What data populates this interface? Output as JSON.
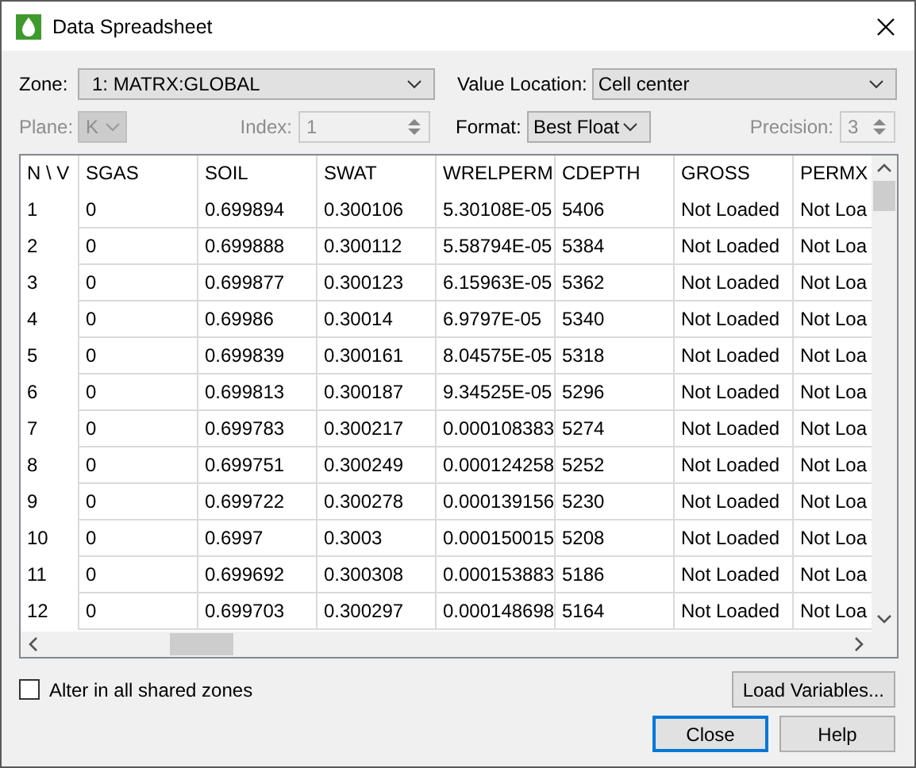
{
  "window": {
    "title": "Data Spreadsheet"
  },
  "zone": {
    "label": "Zone:",
    "value": "1: MATRX:GLOBAL"
  },
  "value_location": {
    "label": "Value Location:",
    "value": "Cell center"
  },
  "plane": {
    "label": "Plane:",
    "value": "K",
    "disabled": true
  },
  "index": {
    "label": "Index:",
    "value": "1",
    "disabled": true
  },
  "format": {
    "label": "Format:",
    "value": "Best Float"
  },
  "precision": {
    "label": "Precision:",
    "value": "3",
    "disabled": true
  },
  "table": {
    "columns": [
      "N \\ V",
      "SGAS",
      "SOIL",
      "SWAT",
      "WRELPERM",
      "CDEPTH",
      "GROSS",
      "PERMX"
    ],
    "rows": [
      [
        "1",
        "0",
        "0.699894",
        "0.300106",
        "5.30108E-05",
        "5406",
        "Not Loaded",
        "Not Loa"
      ],
      [
        "2",
        "0",
        "0.699888",
        "0.300112",
        "5.58794E-05",
        "5384",
        "Not Loaded",
        "Not Loa"
      ],
      [
        "3",
        "0",
        "0.699877",
        "0.300123",
        "6.15963E-05",
        "5362",
        "Not Loaded",
        "Not Loa"
      ],
      [
        "4",
        "0",
        "0.69986",
        "0.30014",
        "6.9797E-05",
        "5340",
        "Not Loaded",
        "Not Loa"
      ],
      [
        "5",
        "0",
        "0.699839",
        "0.300161",
        "8.04575E-05",
        "5318",
        "Not Loaded",
        "Not Loa"
      ],
      [
        "6",
        "0",
        "0.699813",
        "0.300187",
        "9.34525E-05",
        "5296",
        "Not Loaded",
        "Not Loa"
      ],
      [
        "7",
        "0",
        "0.699783",
        "0.300217",
        "0.000108383",
        "5274",
        "Not Loaded",
        "Not Loa"
      ],
      [
        "8",
        "0",
        "0.699751",
        "0.300249",
        "0.000124258",
        "5252",
        "Not Loaded",
        "Not Loa"
      ],
      [
        "9",
        "0",
        "0.699722",
        "0.300278",
        "0.000139156",
        "5230",
        "Not Loaded",
        "Not Loa"
      ],
      [
        "10",
        "0",
        "0.6997",
        "0.3003",
        "0.000150015",
        "5208",
        "Not Loaded",
        "Not Loa"
      ],
      [
        "11",
        "0",
        "0.699692",
        "0.300308",
        "0.000153883",
        "5186",
        "Not Loaded",
        "Not Loa"
      ],
      [
        "12",
        "0",
        "0.699703",
        "0.300297",
        "0.000148698",
        "5164",
        "Not Loaded",
        "Not Loa"
      ]
    ]
  },
  "alter_checkbox": {
    "label": "Alter in all shared zones",
    "checked": false
  },
  "load_button": {
    "label": "Load Variables..."
  },
  "buttons": [
    {
      "label": "Close",
      "default": true
    },
    {
      "label": "Help",
      "default": false
    }
  ]
}
